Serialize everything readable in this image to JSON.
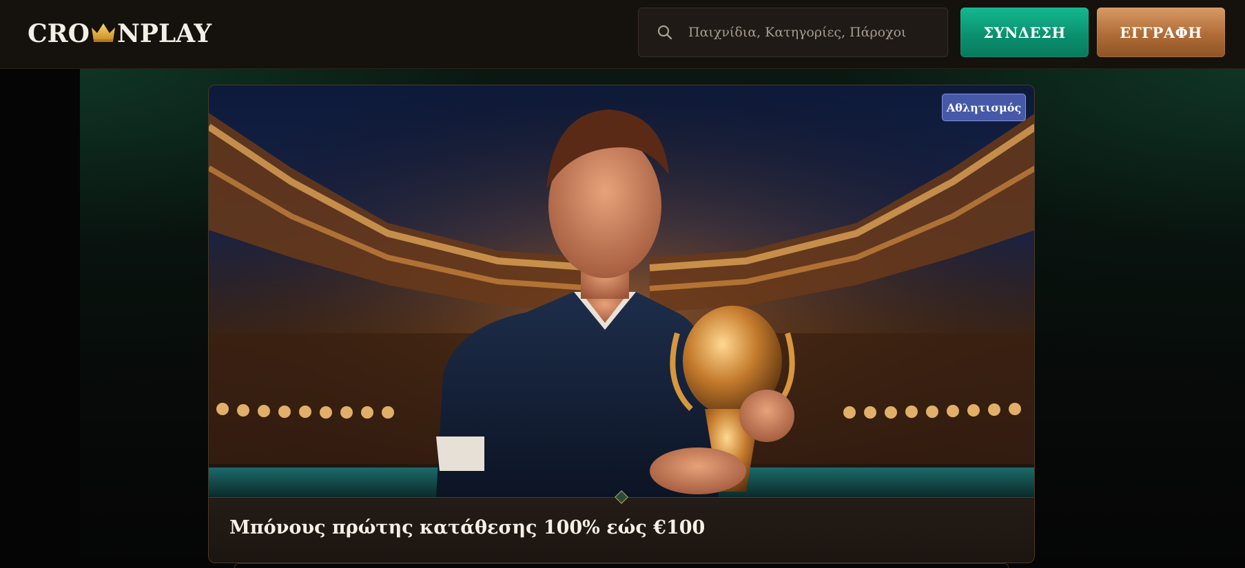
{
  "header": {
    "logo": {
      "text_left": "CRO",
      "text_right": "NPLAY",
      "icon": "crown-icon"
    },
    "search": {
      "placeholder": "Παιχνίδια, Κατηγορίες, Πάροχοι",
      "value": "",
      "icon": "search-icon"
    },
    "login_label": "ΣΥΝΔΕΣΗ",
    "signup_label": "ΕΓΓΡΑΦΗ"
  },
  "promo": {
    "tag": "Αθλητισμός",
    "title": "Μπόνους πρώτης κατάθεσης 100% εώς €100"
  },
  "colors": {
    "login_button": "#0b9170",
    "signup_button": "#b06c36",
    "header_bg": "#15110d",
    "tag_bg": "#4559a8",
    "logo_crown": "#e8b94a"
  }
}
